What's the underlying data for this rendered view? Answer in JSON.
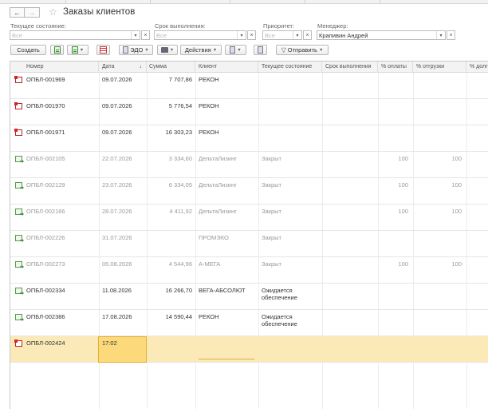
{
  "header": {
    "back_icon": "arrow-left-icon",
    "forward_icon": "arrow-right-icon",
    "favorite_icon": "star-icon",
    "title": "Заказы клиентов"
  },
  "filters": {
    "state": {
      "label": "Текущее состояние:",
      "placeholder": "Все",
      "value": ""
    },
    "deadline": {
      "label": "Срок выполнения:",
      "placeholder": "Все",
      "value": ""
    },
    "priority": {
      "label": "Приоритет:",
      "placeholder": "Все",
      "value": ""
    },
    "manager": {
      "label": "Менеджер:",
      "placeholder": "",
      "value": "Крапивин Андрей"
    }
  },
  "toolbar": {
    "create": "Создать",
    "edo": "ЭДО",
    "actions": "Действия",
    "send": "Отправить"
  },
  "table": {
    "columns": [
      "Номер",
      "Дата",
      "Сумма",
      "Клиент",
      "Текущее состояние",
      "Срок выполнения",
      "% оплаты",
      "% отгрузки",
      "% долг"
    ],
    "sort_indicator": "↓",
    "rows": [
      {
        "icon": "red",
        "number": "ОПБЛ-001969",
        "date": "09.07.2026",
        "sum": "7 707,86",
        "client": "РЕКОН",
        "state": "",
        "deadline": "",
        "paid": "",
        "shipped": "",
        "closed": false
      },
      {
        "icon": "red",
        "number": "ОПБЛ-001970",
        "date": "09.07.2026",
        "sum": "5 776,54",
        "client": "РЕКОН",
        "state": "",
        "deadline": "",
        "paid": "",
        "shipped": "",
        "closed": false
      },
      {
        "icon": "red",
        "number": "ОПБЛ-001971",
        "date": "09.07.2026",
        "sum": "16 303,23",
        "client": "РЕКОН",
        "state": "",
        "deadline": "",
        "paid": "",
        "shipped": "",
        "closed": false
      },
      {
        "icon": "green",
        "number": "ОПБЛ-002105",
        "date": "22.07.2026",
        "sum": "3 334,60",
        "client": "ДельтаЛизинг",
        "state": "Закрыт",
        "deadline": "",
        "paid": "100",
        "shipped": "100",
        "closed": true
      },
      {
        "icon": "green",
        "number": "ОПБЛ-002129",
        "date": "23.07.2026",
        "sum": "6 334,05",
        "client": "ДельтаЛизинг",
        "state": "Закрыт",
        "deadline": "",
        "paid": "100",
        "shipped": "100",
        "closed": true
      },
      {
        "icon": "green",
        "number": "ОПБЛ-002166",
        "date": "28.07.2026",
        "sum": "4 411,92",
        "client": "ДельтаЛизинг",
        "state": "Закрыт",
        "deadline": "",
        "paid": "100",
        "shipped": "100",
        "closed": true
      },
      {
        "icon": "green",
        "number": "ОПБЛ-002226",
        "date": "31.07.2026",
        "sum": "",
        "client": "ПРОМЭКО",
        "state": "Закрыт",
        "deadline": "",
        "paid": "",
        "shipped": "",
        "closed": true
      },
      {
        "icon": "green",
        "number": "ОПБЛ-002273",
        "date": "05.08.2026",
        "sum": "4 544,96",
        "client": "А-МЕГА",
        "state": "Закрыт",
        "deadline": "",
        "paid": "100",
        "shipped": "100",
        "closed": true
      },
      {
        "icon": "green",
        "number": "ОПБЛ-002334",
        "date": "11.08.2026",
        "sum": "16 266,70",
        "client": "ВЕГА-АБСОЛЮТ",
        "state": "Ожидается обеспечение",
        "deadline": "",
        "paid": "",
        "shipped": "",
        "closed": false
      },
      {
        "icon": "green",
        "number": "ОПБЛ-002386",
        "date": "17.08.2026",
        "sum": "14 590,44",
        "client": "РЕКОН",
        "state": "Ожидается обеспечение",
        "deadline": "",
        "paid": "",
        "shipped": "",
        "closed": false
      },
      {
        "icon": "red",
        "number": "ОПБЛ-002424",
        "date": "17:02",
        "sum": "",
        "client": "",
        "state": "",
        "deadline": "",
        "paid": "",
        "shipped": "",
        "closed": false,
        "selected": true
      }
    ]
  }
}
